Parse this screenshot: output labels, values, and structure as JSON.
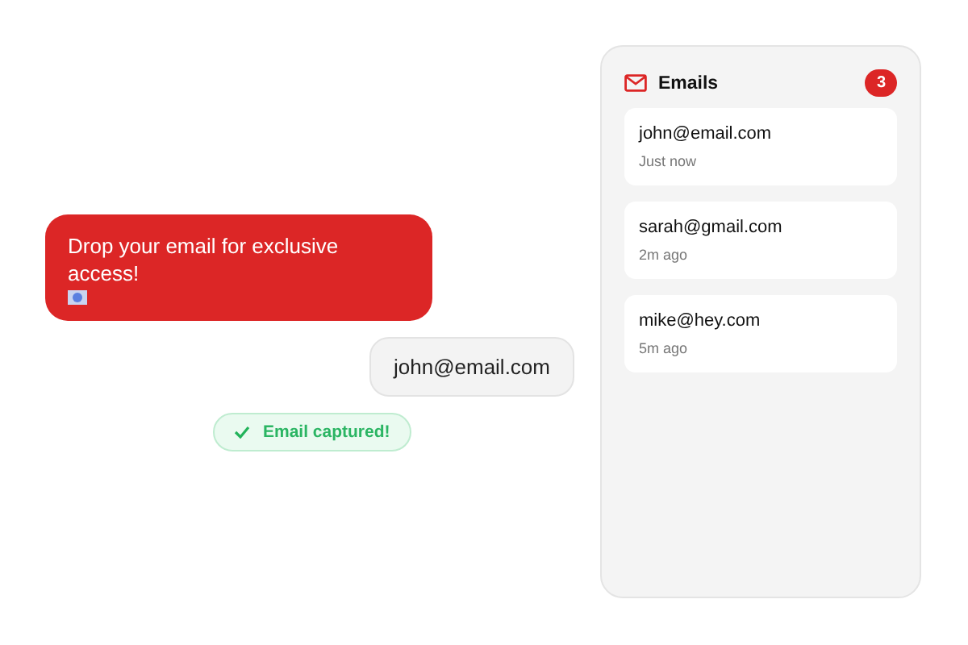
{
  "chat": {
    "prompt": "Drop your email for exclusive access!",
    "reply": "john@email.com",
    "status": "Email captured!"
  },
  "panel": {
    "title": "Emails",
    "count": "3",
    "emails": [
      {
        "address": "john@email.com",
        "time": "Just now"
      },
      {
        "address": "sarah@gmail.com",
        "time": "2m ago"
      },
      {
        "address": "mike@hey.com",
        "time": "5m ago"
      }
    ]
  }
}
